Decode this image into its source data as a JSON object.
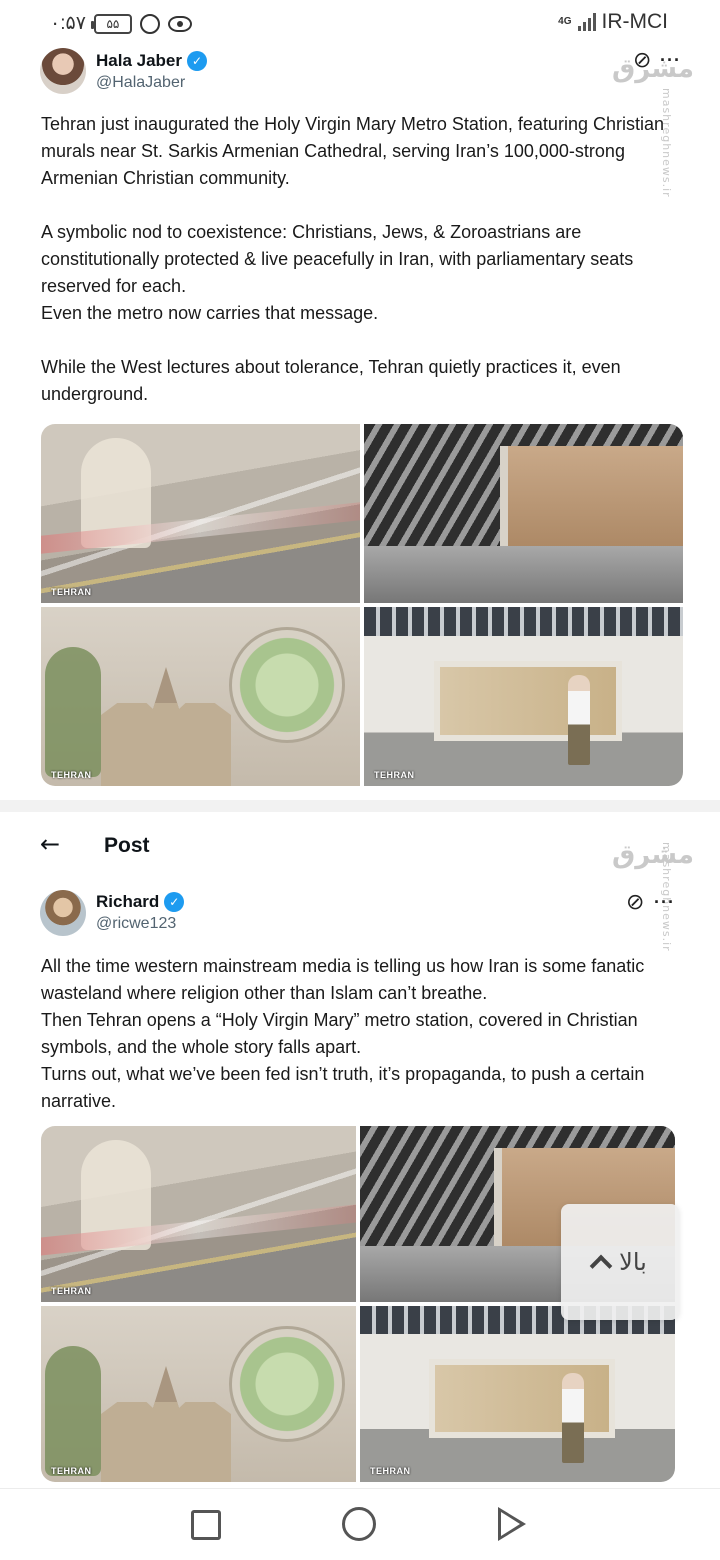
{
  "status_bar": {
    "time": "۰:۵۷",
    "battery": "۵۵",
    "network_type": "4G",
    "carrier": "IR-MCI"
  },
  "post1": {
    "author_name": "Hala Jaber",
    "author_handle": "@HalaJaber",
    "text": "Tehran just inaugurated the Holy Virgin Mary Metro Station, featuring Christian murals near St. Sarkis Armenian Cathedral, serving Iran’s 100,000-strong Armenian Christian community.\n\nA symbolic nod to coexistence: Christians, Jews, & Zoroastrians are constitutionally protected & live peacefully in Iran, with parliamentary seats reserved for each.\nEven the metro now carries that message.\n\nWhile the West lectures about tolerance, Tehran quietly practices it, even underground.",
    "image_label": "TEHRAN"
  },
  "post_header": {
    "title": "Post"
  },
  "post2": {
    "author_name": "Richard",
    "author_handle": "@ricwe123",
    "text": "All the time western mainstream media is telling us how Iran is some fanatic wasteland where religion other than Islam can’t breathe.\nThen Tehran opens a “Holy Virgin Mary” metro station, covered in Christian symbols, and the whole story falls apart.\nTurns out, what we’ve been fed isn’t truth, it’s propaganda, to push a certain narrative.",
    "image_label": "TEHRAN"
  },
  "watermark": {
    "logo": "مشرق",
    "text": "mashreghnews.ir"
  },
  "back_to_top": {
    "label": "بالا"
  },
  "icons": {
    "grok": "⊘",
    "more": "···",
    "back": "←",
    "verified": "✓"
  },
  "colors": {
    "verified": "#1d9bf0",
    "handle": "#536471"
  }
}
